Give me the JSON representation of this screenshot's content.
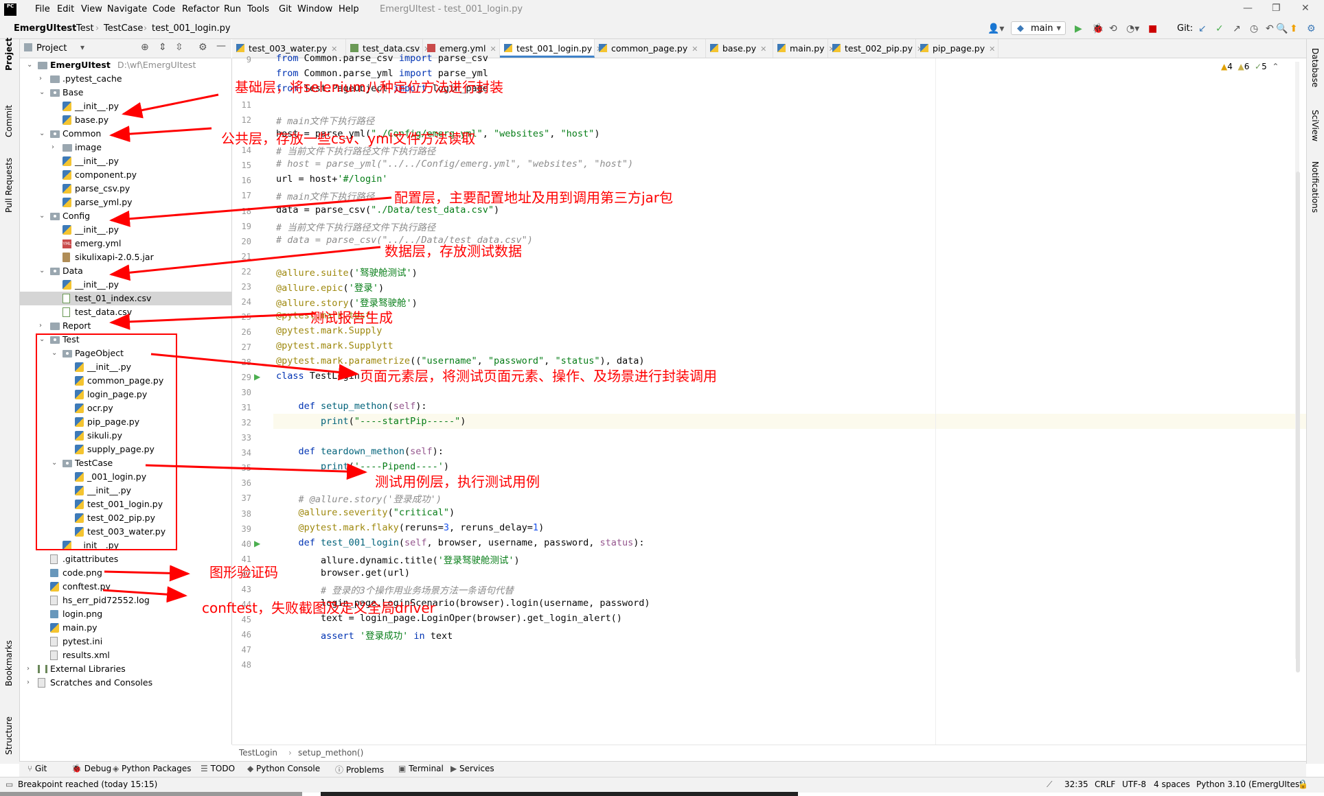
{
  "app": {
    "logo_text": "PC",
    "window_title": "EmergUItest - test_001_login.py",
    "menu": [
      "File",
      "Edit",
      "View",
      "Navigate",
      "Code",
      "Refactor",
      "Run",
      "Tools",
      "Git",
      "Window",
      "Help"
    ]
  },
  "nav": {
    "breadcrumb": [
      "EmergUItest",
      "Test",
      "TestCase",
      "test_001_login.py"
    ],
    "branch": "main",
    "git_label": "Git:"
  },
  "left_strip": [
    "Project",
    "Commit",
    "Pull Requests",
    "Bookmarks",
    "Structure"
  ],
  "right_strip": [
    "Database",
    "SciView",
    "Notifications"
  ],
  "project_panel": {
    "title": "Project",
    "tree": [
      {
        "label": "EmergUItest",
        "hint": "D:\\wf\\EmergUItest",
        "indent": 0,
        "icon": "folder",
        "arrow": "down",
        "bold": true
      },
      {
        "label": ".pytest_cache",
        "indent": 1,
        "icon": "folder",
        "arrow": "right"
      },
      {
        "label": "Base",
        "indent": 1,
        "icon": "pkg",
        "arrow": "down"
      },
      {
        "label": "__init__.py",
        "indent": 2,
        "icon": "py"
      },
      {
        "label": "base.py",
        "indent": 2,
        "icon": "py"
      },
      {
        "label": "Common",
        "indent": 1,
        "icon": "pkg",
        "arrow": "down"
      },
      {
        "label": "image",
        "indent": 2,
        "icon": "folder",
        "arrow": "right"
      },
      {
        "label": "__init__.py",
        "indent": 2,
        "icon": "py"
      },
      {
        "label": "component.py",
        "indent": 2,
        "icon": "py"
      },
      {
        "label": "parse_csv.py",
        "indent": 2,
        "icon": "py"
      },
      {
        "label": "parse_yml.py",
        "indent": 2,
        "icon": "py"
      },
      {
        "label": "Config",
        "indent": 1,
        "icon": "pkg",
        "arrow": "down"
      },
      {
        "label": "__init__.py",
        "indent": 2,
        "icon": "py"
      },
      {
        "label": "emerg.yml",
        "indent": 2,
        "icon": "yml"
      },
      {
        "label": "sikulixapi-2.0.5.jar",
        "indent": 2,
        "icon": "jar"
      },
      {
        "label": "Data",
        "indent": 1,
        "icon": "pkg",
        "arrow": "down"
      },
      {
        "label": "__init__.py",
        "indent": 2,
        "icon": "py"
      },
      {
        "label": "test_01_index.csv",
        "indent": 2,
        "icon": "csv",
        "selected": true
      },
      {
        "label": "test_data.csv",
        "indent": 2,
        "icon": "csv"
      },
      {
        "label": "Report",
        "indent": 1,
        "icon": "folder",
        "arrow": "right"
      },
      {
        "label": "Test",
        "indent": 1,
        "icon": "pkg",
        "arrow": "down"
      },
      {
        "label": "PageObject",
        "indent": 2,
        "icon": "pkg",
        "arrow": "down"
      },
      {
        "label": "__init__.py",
        "indent": 3,
        "icon": "py"
      },
      {
        "label": "common_page.py",
        "indent": 3,
        "icon": "py"
      },
      {
        "label": "login_page.py",
        "indent": 3,
        "icon": "py"
      },
      {
        "label": "ocr.py",
        "indent": 3,
        "icon": "py"
      },
      {
        "label": "pip_page.py",
        "indent": 3,
        "icon": "py"
      },
      {
        "label": "sikuli.py",
        "indent": 3,
        "icon": "py"
      },
      {
        "label": "supply_page.py",
        "indent": 3,
        "icon": "py"
      },
      {
        "label": "TestCase",
        "indent": 2,
        "icon": "pkg",
        "arrow": "down"
      },
      {
        "label": "_001_login.py",
        "indent": 3,
        "icon": "py"
      },
      {
        "label": "__init__.py",
        "indent": 3,
        "icon": "py"
      },
      {
        "label": "test_001_login.py",
        "indent": 3,
        "icon": "py"
      },
      {
        "label": "test_002_pip.py",
        "indent": 3,
        "icon": "py"
      },
      {
        "label": "test_003_water.py",
        "indent": 3,
        "icon": "py"
      },
      {
        "label": "__init__.py",
        "indent": 2,
        "icon": "py"
      },
      {
        "label": ".gitattributes",
        "indent": 1,
        "icon": "file"
      },
      {
        "label": "code.png",
        "indent": 1,
        "icon": "img"
      },
      {
        "label": "conftest.py",
        "indent": 1,
        "icon": "py"
      },
      {
        "label": "hs_err_pid72552.log",
        "indent": 1,
        "icon": "file"
      },
      {
        "label": "login.png",
        "indent": 1,
        "icon": "img"
      },
      {
        "label": "main.py",
        "indent": 1,
        "icon": "py"
      },
      {
        "label": "pytest.ini",
        "indent": 1,
        "icon": "file"
      },
      {
        "label": "results.xml",
        "indent": 1,
        "icon": "file"
      },
      {
        "label": "External Libraries",
        "indent": 0,
        "icon": "lib",
        "arrow": "right"
      },
      {
        "label": "Scratches and Consoles",
        "indent": 0,
        "icon": "file",
        "arrow": "right"
      }
    ]
  },
  "tabs": [
    {
      "label": "test_003_water.py",
      "icon": "py"
    },
    {
      "label": "test_data.csv",
      "icon": "csv"
    },
    {
      "label": "emerg.yml",
      "icon": "yml"
    },
    {
      "label": "test_001_login.py",
      "icon": "py",
      "active": true
    },
    {
      "label": "common_page.py",
      "icon": "py"
    },
    {
      "label": "base.py",
      "icon": "py"
    },
    {
      "label": "main.py",
      "icon": "py"
    },
    {
      "label": "test_002_pip.py",
      "icon": "py"
    },
    {
      "label": "pip_page.py",
      "icon": "py"
    }
  ],
  "inspections": {
    "warnings": "4",
    "weak_warnings": "6",
    "typos": "5"
  },
  "code_lines": [
    {
      "n": "9",
      "html": "<span class='kw'>from</span> Common.parse_csv <span class='kw'>import</span> parse_csv"
    },
    {
      "n": "",
      "html": "<span class='kw'>from</span> Common.parse_yml <span class='kw'>import</span> parse_yml"
    },
    {
      "n": "",
      "html": "<span class='kw'>from</span> Test.PageObject <span class='kw'>import</span> login_page"
    },
    {
      "n": "11",
      "html": ""
    },
    {
      "n": "12",
      "html": "<span class='cm'># main文件下执行路径</span>"
    },
    {
      "n": "",
      "html": "host = parse_yml(<span class='str'>\"./Config/emerg.yml\"</span>, <span class='str'>\"websites\"</span>, <span class='str'>\"host\"</span>)"
    },
    {
      "n": "14",
      "html": "<span class='cm'># 当前文件下执行路径文件下执行路径</span>"
    },
    {
      "n": "15",
      "html": "<span class='cm'># host = parse_yml(\"../../Config/emerg.yml\", \"websites\", \"host\")</span>"
    },
    {
      "n": "16",
      "html": "url = host+<span class='str'>'#/login'</span>"
    },
    {
      "n": "17",
      "html": "<span class='cm'># main文件下执行路径</span>"
    },
    {
      "n": "18",
      "html": "data = parse_csv(<span class='str'>\"./Data/test_data.csv\"</span>)"
    },
    {
      "n": "19",
      "html": "<span class='cm'># 当前文件下执行路径文件下执行路径</span>"
    },
    {
      "n": "20",
      "html": "<span class='cm'># data = parse_csv(\"../../Data/test_data.csv\")</span>"
    },
    {
      "n": "21",
      "html": ""
    },
    {
      "n": "22",
      "html": "<span class='dec'>@allure.suite</span>(<span class='str'>'驽驶舱测试'</span>)"
    },
    {
      "n": "23",
      "html": "<span class='dec'>@allure.epic</span>(<span class='str'>'登录'</span>)"
    },
    {
      "n": "24",
      "html": "<span class='dec'>@allure.story</span>(<span class='str'>'登录驽驶舱'</span>)"
    },
    {
      "n": "25",
      "html": "<span class='dec'>@pytest.mark.test</span>"
    },
    {
      "n": "26",
      "html": "<span class='dec'>@pytest.mark.Supply</span>"
    },
    {
      "n": "27",
      "html": "<span class='dec'>@pytest.mark.Supplytt</span>"
    },
    {
      "n": "28",
      "html": "<span class='dec'>@pytest.mark.parametrize</span>((<span class='str'>\"username\"</span>, <span class='str'>\"password\"</span>, <span class='str'>\"status\"</span>), data)"
    },
    {
      "n": "29",
      "html": "<span class='kw'>class</span> TestLogin:",
      "run": true
    },
    {
      "n": "30",
      "html": ""
    },
    {
      "n": "31",
      "html": "    <span class='kw'>def</span> <span class='fn'>setup_methon</span>(<span class='slf'>self</span>):"
    },
    {
      "n": "32",
      "html": "        <span class='fn'>print</span>(<span class='str'>\"----startPip-----\"</span>)"
    },
    {
      "n": "33",
      "html": ""
    },
    {
      "n": "34",
      "html": "    <span class='kw'>def</span> <span class='fn'>teardown_methon</span>(<span class='slf'>self</span>):"
    },
    {
      "n": "35",
      "html": "        <span class='fn'>print</span>(<span class='str'>'----Pipend----'</span>)"
    },
    {
      "n": "36",
      "html": ""
    },
    {
      "n": "37",
      "html": "    <span class='cm'># @allure.story('登录成功')</span>"
    },
    {
      "n": "38",
      "html": "    <span class='dec'>@allure.severity</span>(<span class='str'>\"critical\"</span>)"
    },
    {
      "n": "39",
      "html": "    <span class='dec'>@pytest.mark.flaky</span>(reruns=<span class='num'>3</span>, reruns_delay=<span class='num'>1</span>)"
    },
    {
      "n": "40",
      "html": "    <span class='kw'>def</span> <span class='fn'>test_001_login</span>(<span class='slf'>self</span>, browser, username, password, <span class='slf'>status</span>):",
      "run": true
    },
    {
      "n": "41",
      "html": "        allure.dynamic.title(<span class='str'>'登录驽驶舱测试'</span>)"
    },
    {
      "n": "42",
      "html": "        browser.get(url)"
    },
    {
      "n": "43",
      "html": "        <span class='cm'># 登录的3个操作用业务场景方法一条语句代替</span>"
    },
    {
      "n": "44",
      "html": "        login_page.LoginScenario(browser).login(username, password)"
    },
    {
      "n": "45",
      "html": "        text = login_page.LoginOper(browser).get_login_alert()"
    },
    {
      "n": "46",
      "html": "        <span class='kw'>assert</span> <span class='str'>'登录成功'</span> <span class='kw'>in</span> text"
    },
    {
      "n": "47",
      "html": ""
    },
    {
      "n": "48",
      "html": ""
    }
  ],
  "editor_breadcrumb": [
    "TestLogin",
    "setup_methon()"
  ],
  "bottom_tools": [
    "Git",
    "Debug",
    "Python Packages",
    "TODO",
    "Python Console",
    "Problems",
    "Terminal",
    "Services"
  ],
  "status": {
    "message": "Breakpoint reached (today 15:15)",
    "position": "32:35",
    "line_sep": "CRLF",
    "encoding": "UTF-8",
    "indent": "4 spaces",
    "interpreter": "Python 3.10 (EmergUItest)"
  },
  "annotations": [
    {
      "text": "基础层，将selenium八种定位方法进行封装"
    },
    {
      "text": "公共层，存放一些csv、yml文件方法读取"
    },
    {
      "text": "配置层，主要配置地址及用到调用第三方jar包"
    },
    {
      "text": "数据层，存放测试数据"
    },
    {
      "text": "测试报告生成"
    },
    {
      "text": "页面元素层，将测试页面元素、操作、及场景进行封装调用"
    },
    {
      "text": "测试用例层，执行测试用例"
    },
    {
      "text": "图形验证码"
    },
    {
      "text": "conftest，失败截图及定义全局driver"
    }
  ],
  "colors": {
    "annotation": "#ff0000",
    "tab_active_underline": "#4083c9",
    "current_line": "#fcfaed"
  }
}
